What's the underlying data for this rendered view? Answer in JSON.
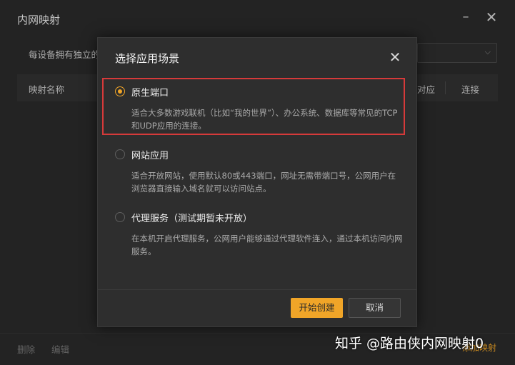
{
  "window": {
    "title": "内网映射",
    "minimize_glyph": "–",
    "close_glyph": "✕"
  },
  "background": {
    "description_text": "每设备拥有独立的",
    "select_chevron": "⌵",
    "table_headers": {
      "name": "映射名称",
      "corresponding": "对应",
      "connect": "连接"
    },
    "footer": {
      "delete": "删除",
      "edit": "编辑",
      "add": "添加映射"
    }
  },
  "dialog": {
    "title": "选择应用场景",
    "close_glyph": "✕",
    "options": [
      {
        "label": "原生端口",
        "description": "适合大多数游戏联机（比如“我的世界”）、办公系统、数据库等常见的TCP和UDP应用的连接。",
        "selected": true
      },
      {
        "label": "网站应用",
        "description": "适合开放网站，使用默认80或443端口，网址无需带端口号，公网用户在浏览器直接输入域名就可以访问站点。",
        "selected": false
      },
      {
        "label": "代理服务（测试期暂未开放）",
        "description": "在本机开启代理服务，公网用户能够通过代理软件连入，通过本机访问内网服务。",
        "selected": false
      }
    ],
    "buttons": {
      "start": "开始创建",
      "cancel": "取消"
    }
  },
  "watermark": "知乎 @路由侠内网映射0",
  "colors": {
    "accent": "#f0a528",
    "highlight_border": "#d63a3a",
    "background": "#2b2b2b",
    "dialog_background": "#2e2e2e"
  }
}
